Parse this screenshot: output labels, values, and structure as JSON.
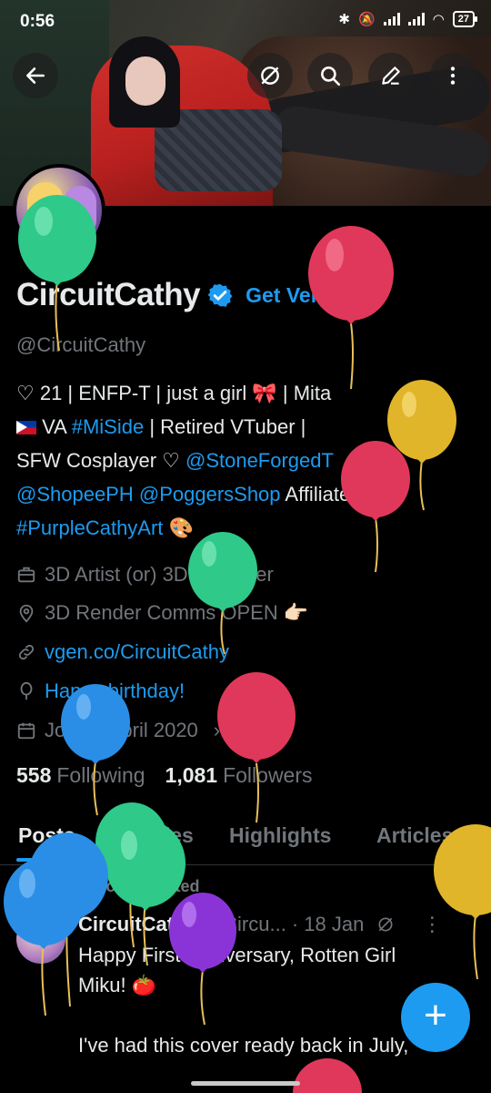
{
  "status_bar": {
    "time": "0:56",
    "battery": "27"
  },
  "header": {
    "back_icon": "arrow-left-icon",
    "actions": [
      "grok-icon",
      "search-icon",
      "edit-icon",
      "more-vertical-icon"
    ]
  },
  "profile": {
    "name": "CircuitCathy",
    "get_verified": "Get Verified",
    "handle": "@CircuitCathy",
    "bio": {
      "line1": "♡ 21 | ENFP-T | just a girl 🎀 | Mita",
      "line2_pre": " VA ",
      "line2_tag": "#MiSide",
      "line2_post": " | Retired VTuber |",
      "line3_pre": "SFW Cosplayer ♡ ",
      "line3_mention": "@StoneForgedT",
      "line4_mention1": "@ShopeePH",
      "line4_mention2": "@PoggersShop",
      "line4_post": " Affiliate ♡",
      "line5_tag": "#PurpleCathyArt",
      "line5_post": " 🎨"
    },
    "category": "3D Artist (or) 3D Designer",
    "location": "3D Render Comms OPEN 👉🏻",
    "website": "vgen.co/CircuitCathy",
    "birthday": "Happy birthday!",
    "joined": "Joined April 2020",
    "following_count": "558",
    "following_label": "Following",
    "followers_count": "1,081",
    "followers_label": "Followers"
  },
  "tabs": [
    "Posts",
    "Replies",
    "Highlights",
    "Articles"
  ],
  "post": {
    "repost_label": "You reposted",
    "author": "CircuitCathy",
    "handle": "@Circu...",
    "date": "· 18 Jan",
    "text_line1": "Happy First Anniversary, Rotten Girl",
    "text_line2": "Miku! 🍅",
    "text_line3": "I've had this cover ready back in July,"
  },
  "fab": "+",
  "colors": {
    "accent": "#1d9bf0",
    "muted": "#71767b",
    "text": "#e7e9ea",
    "bg": "#000000"
  }
}
